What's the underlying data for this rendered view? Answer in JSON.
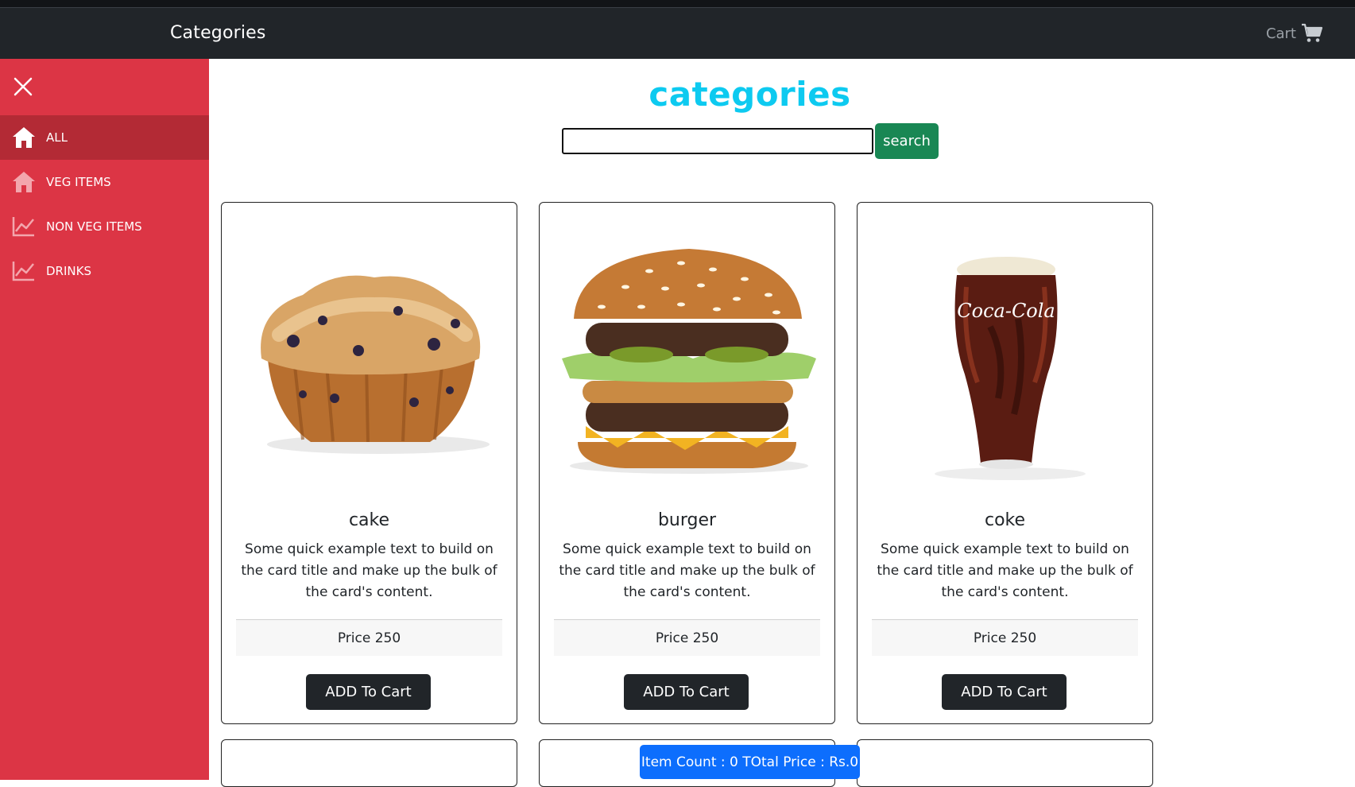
{
  "navbar": {
    "title": "Categories",
    "cart_label": "Cart",
    "cart_icon": "cart-icon"
  },
  "sidebar": {
    "close_icon": "close-icon",
    "accent_color": "#dc3545",
    "items": [
      {
        "label": "ALL",
        "icon": "home-icon",
        "active": true
      },
      {
        "label": "VEG ITEMS",
        "icon": "home-icon",
        "active": false
      },
      {
        "label": "NON VEG ITEMS",
        "icon": "chart-line-icon",
        "active": false
      },
      {
        "label": "DRINKS",
        "icon": "chart-line-icon",
        "active": false
      }
    ]
  },
  "main": {
    "heading": "categories",
    "heading_color": "#0dcaf0",
    "search": {
      "value": "",
      "placeholder": "",
      "button_label": "search"
    },
    "cards": [
      {
        "title": "cake",
        "text": "Some quick example text to build on the card title and make up the bulk of the card's content.",
        "price": "Price 250",
        "button_label": "ADD To Cart",
        "image": "muffin-image"
      },
      {
        "title": "burger",
        "text": "Some quick example text to build on the card title and make up the bulk of the card's content.",
        "price": "Price 250",
        "button_label": "ADD To Cart",
        "image": "burger-image"
      },
      {
        "title": "coke",
        "text": "Some quick example text to build on the card title and make up the bulk of the card's content.",
        "price": "Price 250",
        "button_label": "ADD To Cart",
        "image": "coca-cola-glass-image",
        "image_text": "Coca-Cola"
      }
    ]
  },
  "summary": {
    "text": "Item Count : 0 TOtal Price : Rs.0",
    "color": "#0d6efd"
  }
}
